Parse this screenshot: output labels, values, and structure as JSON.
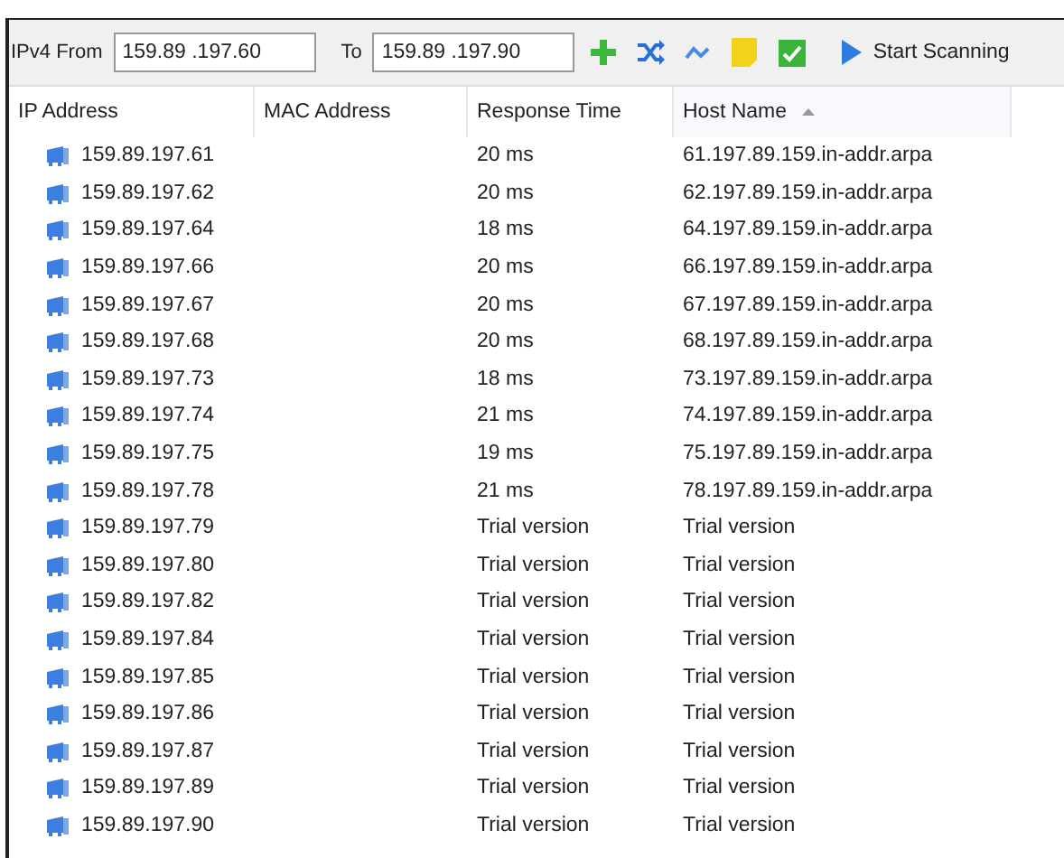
{
  "toolbar": {
    "from_label": "IPv4 From",
    "from_value": "159.89 .197.60",
    "to_label": "To",
    "to_value": "159.89 .197.90",
    "start_button": "Start Scanning"
  },
  "table": {
    "columns": [
      {
        "label": "IP Address",
        "sorted": false
      },
      {
        "label": "MAC Address",
        "sorted": false
      },
      {
        "label": "Response Time",
        "sorted": false
      },
      {
        "label": "Host Name",
        "sorted": true
      }
    ],
    "rows": [
      {
        "ip": "159.89.197.61",
        "response": "20 ms",
        "host": "61.197.89.159.in-addr.arpa"
      },
      {
        "ip": "159.89.197.62",
        "response": "20 ms",
        "host": "62.197.89.159.in-addr.arpa"
      },
      {
        "ip": "159.89.197.64",
        "response": "18 ms",
        "host": "64.197.89.159.in-addr.arpa"
      },
      {
        "ip": "159.89.197.66",
        "response": "20 ms",
        "host": "66.197.89.159.in-addr.arpa"
      },
      {
        "ip": "159.89.197.67",
        "response": "20 ms",
        "host": "67.197.89.159.in-addr.arpa"
      },
      {
        "ip": "159.89.197.68",
        "response": "20 ms",
        "host": "68.197.89.159.in-addr.arpa"
      },
      {
        "ip": "159.89.197.73",
        "response": "18 ms",
        "host": "73.197.89.159.in-addr.arpa"
      },
      {
        "ip": "159.89.197.74",
        "response": "21 ms",
        "host": "74.197.89.159.in-addr.arpa"
      },
      {
        "ip": "159.89.197.75",
        "response": "19 ms",
        "host": "75.197.89.159.in-addr.arpa"
      },
      {
        "ip": "159.89.197.78",
        "response": "21 ms",
        "host": "78.197.89.159.in-addr.arpa"
      },
      {
        "ip": "159.89.197.79",
        "response": "Trial version",
        "host": "Trial version"
      },
      {
        "ip": "159.89.197.80",
        "response": "Trial version",
        "host": "Trial version"
      },
      {
        "ip": "159.89.197.82",
        "response": "Trial version",
        "host": "Trial version"
      },
      {
        "ip": "159.89.197.84",
        "response": "Trial version",
        "host": "Trial version"
      },
      {
        "ip": "159.89.197.85",
        "response": "Trial version",
        "host": "Trial version"
      },
      {
        "ip": "159.89.197.86",
        "response": "Trial version",
        "host": "Trial version"
      },
      {
        "ip": "159.89.197.87",
        "response": "Trial version",
        "host": "Trial version"
      },
      {
        "ip": "159.89.197.89",
        "response": "Trial version",
        "host": "Trial version"
      },
      {
        "ip": "159.89.197.90",
        "response": "Trial version",
        "host": "Trial version"
      }
    ]
  }
}
